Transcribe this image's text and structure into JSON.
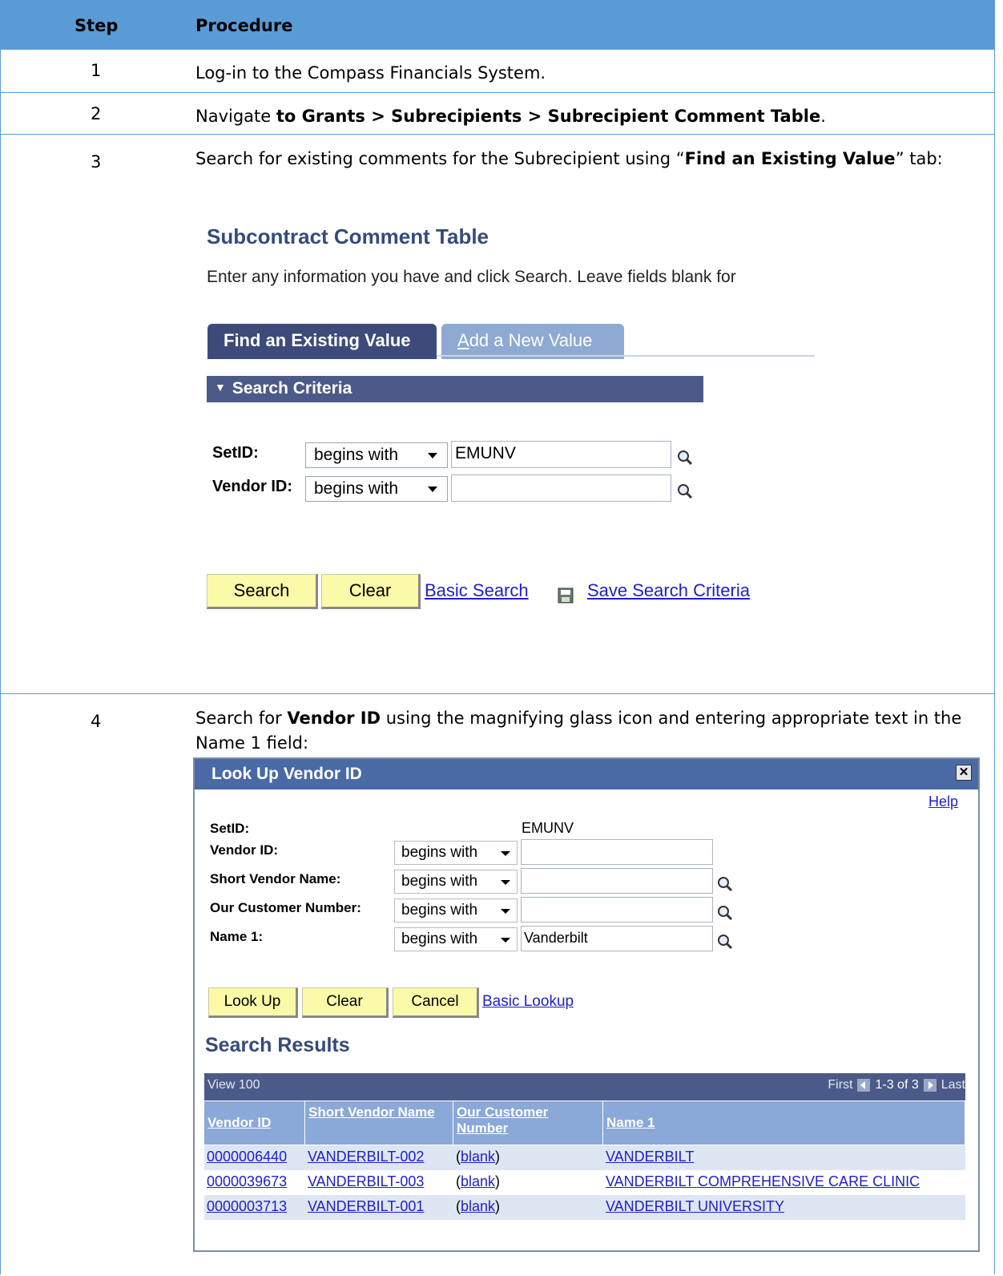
{
  "table": {
    "headers": {
      "step": "Step",
      "procedure": "Procedure"
    },
    "rows": [
      {
        "num": "1",
        "text": "Log-in to the Compass Financials System."
      },
      {
        "num": "2",
        "text_pre": "Navigate ",
        "text_bold": "to Grants > Subrecipients > Subrecipient Comment Table",
        "text_post": "."
      },
      {
        "num": "3",
        "text_pre": "Search for existing comments for the Subrecipient using “",
        "text_bold": "Find an Existing Value",
        "text_post": "” tab:"
      },
      {
        "num": "4",
        "text_pre": "Search for ",
        "text_bold": "Vendor ID",
        "text_post": " using the magnifying glass icon and entering appropriate text in the Name 1 field:"
      }
    ]
  },
  "search_page": {
    "title": "Subcontract Comment Table",
    "instructions": "Enter any information you have and click Search. Leave fields blank for",
    "tab_find": "Find an Existing Value",
    "tab_add_prefix": "A",
    "tab_add_rest": "dd a New Value",
    "section": "Search Criteria",
    "setid_label": "SetID:",
    "setid_operator": "begins with",
    "setid_value": "EMUNV",
    "vendor_label": "Vendor ID:",
    "vendor_operator": "begins with",
    "vendor_value": "",
    "search_button": "Search",
    "clear_button": "Clear",
    "basic_search_link": "Basic Search",
    "save_criteria_link": "Save Search Criteria"
  },
  "lookup": {
    "title": "Look Up Vendor ID",
    "help": "Help",
    "setid_label": "SetID:",
    "setid_value": "EMUNV",
    "fields": [
      {
        "label": "Vendor ID:",
        "operator": "begins with",
        "value": ""
      },
      {
        "label": "Short Vendor Name:",
        "operator": "begins with",
        "value": ""
      },
      {
        "label": "Our Customer Number:",
        "operator": "begins with",
        "value": ""
      },
      {
        "label": "Name 1:",
        "operator": "begins with",
        "value": "Vanderbilt"
      }
    ],
    "buttons": {
      "lookup": "Look Up",
      "clear": "Clear",
      "cancel": "Cancel",
      "basic_lookup": "Basic Lookup"
    },
    "results_title": "Search Results",
    "grid_view": "View 100",
    "grid_first": "First",
    "grid_range": "1-3 of 3",
    "grid_last": "Last",
    "columns": [
      "Vendor ID",
      "Short Vendor Name",
      "Our Customer Number",
      "Name 1"
    ],
    "rows": [
      {
        "vendor_id": "0000006440",
        "short_name": "VANDERBILT-002",
        "customer_number_open": "(",
        "customer_number": "blank",
        "customer_number_close": ")",
        "name1": "VANDERBILT"
      },
      {
        "vendor_id": "0000039673",
        "short_name": "VANDERBILT-003",
        "customer_number_open": "(",
        "customer_number": "blank",
        "customer_number_close": ")",
        "name1": "VANDERBILT COMPREHENSIVE CARE CLINIC"
      },
      {
        "vendor_id": "0000003713",
        "short_name": "VANDERBILT-001",
        "customer_number_open": "(",
        "customer_number": "blank",
        "customer_number_close": ")",
        "name1": "VANDERBILT UNIVERSITY"
      }
    ]
  },
  "colors": {
    "table_header": "#5b9bd5",
    "tab_active": "#3c4b79",
    "button": "#fafaa8",
    "link": "#2020c8"
  },
  "icons": [
    "magnifying-glass-icon",
    "save-icon",
    "close-icon",
    "dropdown-arrow-icon",
    "previous-page-icon",
    "next-page-icon"
  ]
}
